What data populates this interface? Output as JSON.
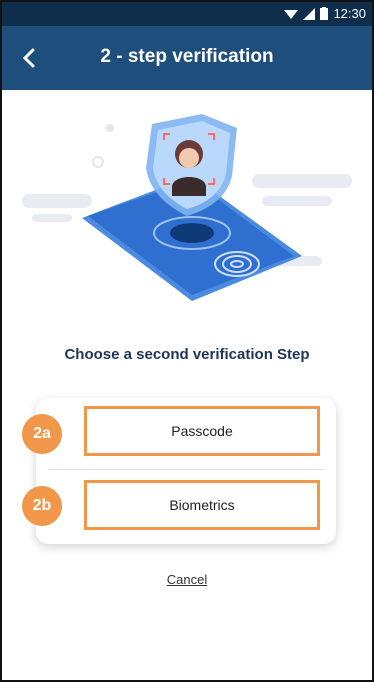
{
  "status_bar": {
    "time": "12:30"
  },
  "header": {
    "title": "2 - step verification"
  },
  "main": {
    "prompt": "Choose a second verification Step",
    "options": [
      {
        "badge": "2a",
        "label": "Passcode"
      },
      {
        "badge": "2b",
        "label": "Biometrics"
      }
    ],
    "cancel_label": "Cancel"
  },
  "colors": {
    "app_bar": "#1d4e7c",
    "status_bar": "#0f2d4c",
    "highlight": "#f0974a",
    "illustration_blue": "#2f6fcf"
  }
}
